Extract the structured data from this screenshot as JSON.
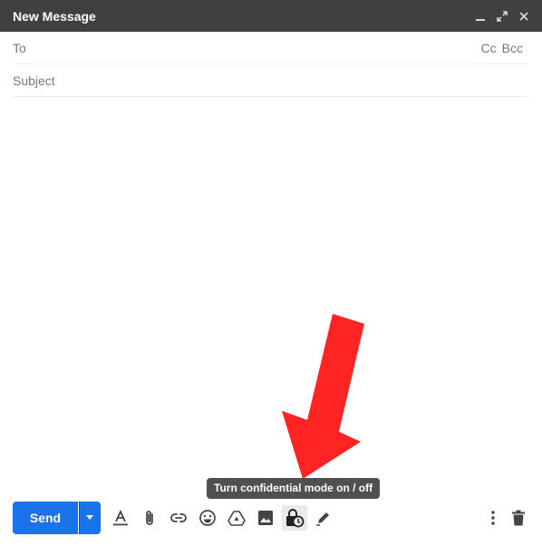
{
  "window": {
    "title": "New Message"
  },
  "recipients": {
    "to_label": "To",
    "cc_label": "Cc",
    "bcc_label": "Bcc"
  },
  "subject": {
    "placeholder": "Subject"
  },
  "toolbar": {
    "send_label": "Send",
    "tooltip": "Turn confidential mode on / off",
    "icons": [
      "send-options-icon",
      "formatting-options-icon",
      "attach-files-icon",
      "insert-link-icon",
      "insert-emoji-icon",
      "insert-drive-icon",
      "insert-photo-icon",
      "confidential-mode-icon",
      "signature-icon",
      "more-options-icon",
      "discard-draft-icon"
    ]
  },
  "colors": {
    "titlebar": "#404040",
    "send_button": "#1a73e8",
    "tooltip": "#505050",
    "annotation_arrow": "#ff2424"
  }
}
